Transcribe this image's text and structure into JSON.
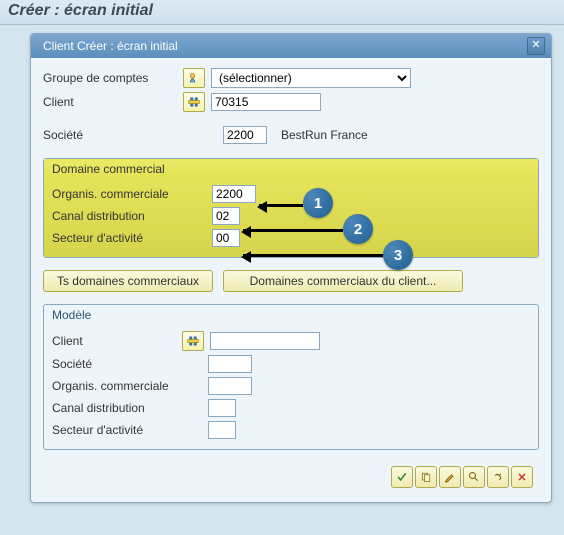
{
  "page_title": "Créer : écran initial",
  "dialog": {
    "title": "Client Créer : écran initial"
  },
  "header_form": {
    "account_group_label": "Groupe de comptes",
    "account_group_value": "(sélectionner)",
    "client_label": "Client",
    "client_value": "70315"
  },
  "society": {
    "label": "Société",
    "value": "2200",
    "name": "BestRun France"
  },
  "commercial": {
    "title": "Domaine commercial",
    "sales_org_label": "Organis. commerciale",
    "sales_org_value": "2200",
    "dist_channel_label": "Canal distribution",
    "dist_channel_value": "02",
    "division_label": "Secteur d'activité",
    "division_value": "00"
  },
  "buttons": {
    "all_sales_areas": "Ts domaines commerciaux",
    "client_sales_areas": "Domaines commerciaux du client..."
  },
  "model": {
    "title": "Modèle",
    "client_label": "Client",
    "client_value": "",
    "society_label": "Société",
    "society_value": "",
    "sales_org_label": "Organis. commerciale",
    "sales_org_value": "",
    "dist_channel_label": "Canal distribution",
    "dist_channel_value": "",
    "division_label": "Secteur d'activité",
    "division_value": ""
  },
  "annotation": {
    "b1": "1",
    "b2": "2",
    "b3": "3"
  }
}
